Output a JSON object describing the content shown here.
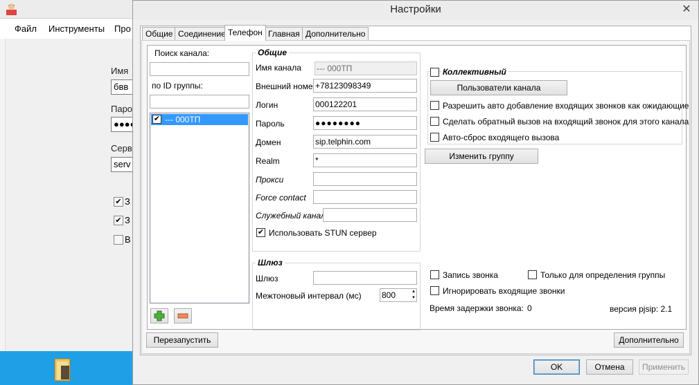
{
  "background_app": {
    "menu": [
      "Файл",
      "Инструменты",
      "Про"
    ],
    "labels": {
      "name": "Имя",
      "password": "Паро",
      "server": "Серв"
    },
    "fields": {
      "name": "бвв",
      "password": "●●●●",
      "server": "serv"
    },
    "checks": [
      {
        "mark": "✔",
        "label": "З"
      },
      {
        "mark": "✔",
        "label": "З"
      },
      {
        "mark": "",
        "label": "В"
      }
    ]
  },
  "dialog": {
    "title": "Настройки",
    "close_glyph": "✕",
    "tabs": [
      "Общие",
      "Соединение",
      "Телефон",
      "Главная",
      "Дополнительно"
    ],
    "active_tab": "Телефон",
    "channel_search": {
      "search_label": "Поиск канала:",
      "search_value": "",
      "group_id_label": "по ID группы:",
      "group_id_value": "",
      "items": [
        {
          "label": "--- 000ТП",
          "checked": "✔"
        }
      ]
    },
    "general_group": {
      "title": "Общие",
      "channel_name_label": "Имя канала",
      "channel_name_value": "--- 000ТП",
      "external_number_label": "Внешний номер",
      "external_number_value": "+78123098349",
      "login_label": "Логин",
      "login_value": "000122201",
      "password_label": "Пароль",
      "password_value": "●●●●●●●●",
      "domain_label": "Домен",
      "domain_value": "sip.telphin.com",
      "realm_label": "Realm",
      "realm_value": "*",
      "proxy_label": "Прокси",
      "proxy_value": "",
      "force_contact_label": "Force contact",
      "force_contact_value": "",
      "service_channel_label": "Служебный канал",
      "service_channel_value": "",
      "stun_label": "Использовать STUN сервер",
      "stun_checked": "✔"
    },
    "gateway_group": {
      "title": "Шлюз",
      "gateway_label": "Шлюз",
      "gateway_value": "",
      "interval_label": "Межтоновый интервал (мс)",
      "interval_value": "800",
      "spin_up": "▲",
      "spin_down": "▼"
    },
    "collective": {
      "title": "Коллективный",
      "checked": "",
      "channel_users_button": "Пользователи канала",
      "options": [
        "Разрешить авто добавление входящих звонков как ожидающие",
        "Сделать обратный вызов на входящий звонок для этого канала",
        "Авто-сброс входящего вызова"
      ]
    },
    "change_group_button": "Изменить группу",
    "call_options": {
      "record_call": "Запись звонка",
      "only_group_detection": "Только для определения группы",
      "ignore_incoming": "Игнорировать входящие звонки",
      "delay_label": "Время задержки звонка:",
      "delay_value": "0",
      "version_label": "версия pjsip: 2.1"
    },
    "restart_button": "Перезапустить",
    "additional_button": "Дополнительно",
    "ok_button": "OK",
    "cancel_button": "Отмена",
    "apply_button": "Применить"
  },
  "colors": {
    "selection": "#3399ff",
    "taskbar": "#1fa0e6",
    "add_icon": "#4caf3a",
    "remove_icon": "#f08a5a"
  }
}
